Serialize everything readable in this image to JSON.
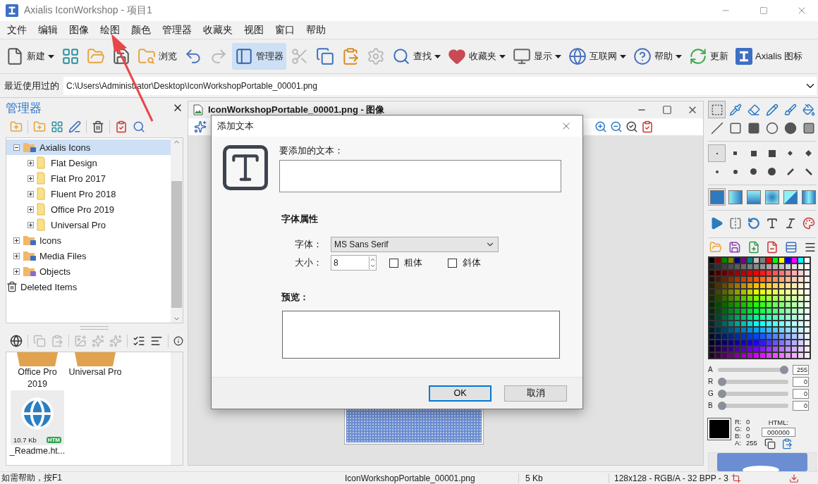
{
  "window": {
    "title": "Axialis IconWorkshop - 项目1"
  },
  "menu": [
    "文件",
    "编辑",
    "图像",
    "绘图",
    "颜色",
    "管理器",
    "收藏夹",
    "视图",
    "窗口",
    "帮助"
  ],
  "toolbar": [
    {
      "kind": "new",
      "label": "新建",
      "menu": true,
      "selected": false,
      "disabled": false
    },
    {
      "kind": "layout",
      "menu": false,
      "selected": false,
      "disabled": false
    },
    {
      "kind": "open",
      "menu": false,
      "selected": false,
      "disabled": false
    },
    {
      "kind": "save",
      "menu": false,
      "selected": false,
      "disabled": false
    },
    {
      "kind": "browse",
      "label": "浏览",
      "menu": false,
      "selected": false,
      "disabled": false
    },
    {
      "kind": "undo",
      "menu": false,
      "selected": false,
      "disabled": false
    },
    {
      "kind": "redo",
      "menu": false,
      "selected": false,
      "disabled": true
    },
    {
      "kind": "manager",
      "label": "管理器",
      "menu": false,
      "selected": true,
      "disabled": false
    },
    {
      "kind": "cut",
      "menu": false,
      "selected": false,
      "disabled": true
    },
    {
      "kind": "copy",
      "menu": false,
      "selected": false,
      "disabled": false
    },
    {
      "kind": "paste",
      "menu": false,
      "selected": false,
      "disabled": false
    },
    {
      "kind": "settings",
      "menu": false,
      "selected": false,
      "disabled": true
    },
    {
      "kind": "search",
      "label": "查找",
      "menu": true,
      "selected": false,
      "disabled": false
    },
    {
      "kind": "favorites",
      "label": "收藏夹",
      "menu": true,
      "selected": false,
      "disabled": false
    },
    {
      "kind": "display",
      "label": "显示",
      "menu": true,
      "selected": false,
      "disabled": false
    },
    {
      "kind": "internet",
      "label": "互联网",
      "menu": true,
      "selected": false,
      "disabled": false
    },
    {
      "kind": "help",
      "label": "帮助",
      "menu": true,
      "selected": false,
      "disabled": false
    },
    {
      "kind": "update",
      "label": "更新",
      "menu": false,
      "selected": false,
      "disabled": false
    },
    {
      "kind": "logo",
      "label": "Axialis 图标",
      "menu": false,
      "selected": false,
      "disabled": false
    }
  ],
  "recent": {
    "label": "最近使用过的",
    "value": "C:\\Users\\Administrator\\Desktop\\IconWorkshopPortable_00001.png"
  },
  "manager": {
    "title": "管理器",
    "tree": [
      {
        "label": "Axialis Icons",
        "kind": "library",
        "expanded": true,
        "selected": true,
        "children": [
          {
            "label": "Flat Design",
            "kind": "folder",
            "expanded": false,
            "selected": false
          },
          {
            "label": "Flat Pro 2017",
            "kind": "folder",
            "expanded": false,
            "selected": false
          },
          {
            "label": "Fluent Pro 2018",
            "kind": "folder",
            "expanded": false,
            "selected": false
          },
          {
            "label": "Office Pro 2019",
            "kind": "folder",
            "expanded": false,
            "selected": false
          },
          {
            "label": "Universal Pro",
            "kind": "folder",
            "expanded": false,
            "selected": false
          }
        ]
      },
      {
        "label": "Icons",
        "kind": "icons",
        "expanded": false,
        "selected": false
      },
      {
        "label": "Media Files",
        "kind": "media",
        "expanded": false,
        "selected": false
      },
      {
        "label": "Objects",
        "kind": "objects",
        "expanded": false,
        "selected": false
      },
      {
        "label": "Deleted Items",
        "kind": "trash",
        "selected": false
      }
    ],
    "files": [
      {
        "kind": "folder",
        "label": "Office Pro 2019"
      },
      {
        "kind": "folder",
        "label": "Universal Pro"
      },
      {
        "kind": "file",
        "label": "_Readme.ht...",
        "size": "10.7 Kb",
        "badge": "HTM"
      }
    ]
  },
  "document": {
    "title": "IconWorkshopPortable_00001.png - 图像"
  },
  "dialog": {
    "title": "添加文本",
    "text_label": "要添加的文本：",
    "section": "字体属性",
    "font_label": "字体：",
    "font": "MS Sans Serif",
    "size_label": "大小：",
    "size": "8",
    "options": [
      {
        "label": "粗体",
        "checked": false
      },
      {
        "label": "斜体",
        "checked": false
      }
    ],
    "preview_label": "预览：",
    "buttons": [
      {
        "label": "OK",
        "default": true
      },
      {
        "label": "取消",
        "default": false
      }
    ]
  },
  "tools": [
    {
      "kind": "select",
      "selected": true
    },
    {
      "kind": "picker",
      "selected": false
    },
    {
      "kind": "eraser",
      "selected": false
    },
    {
      "kind": "pencil",
      "selected": false
    },
    {
      "kind": "brush",
      "selected": false
    },
    {
      "kind": "bucket",
      "selected": false
    },
    {
      "kind": "line",
      "selected": false
    },
    {
      "kind": "rect",
      "selected": false
    },
    {
      "kind": "rect-fill",
      "selected": false
    },
    {
      "kind": "ellipse",
      "selected": false
    },
    {
      "kind": "ellipse-fill",
      "selected": false
    },
    {
      "kind": "shaded",
      "selected": false
    }
  ],
  "brushes": [
    {
      "kind": "dot",
      "selected": true
    },
    {
      "kind": "small-square",
      "selected": false
    },
    {
      "kind": "square",
      "selected": false
    },
    {
      "kind": "large-square",
      "selected": false
    },
    {
      "kind": "diamond",
      "selected": false
    },
    {
      "kind": "large-diamond",
      "selected": false
    },
    {
      "kind": "tiny-round",
      "selected": false
    },
    {
      "kind": "small-round",
      "selected": false
    },
    {
      "kind": "round",
      "selected": false
    },
    {
      "kind": "large-round",
      "selected": false
    },
    {
      "kind": "slash",
      "selected": false
    },
    {
      "kind": "backslash",
      "selected": false
    }
  ],
  "fills": [
    {
      "kind": "solid",
      "selected": true
    },
    {
      "kind": "linear",
      "selected": false
    },
    {
      "kind": "vertical",
      "selected": false
    },
    {
      "kind": "radial",
      "selected": false
    },
    {
      "kind": "diagonal",
      "selected": false
    },
    {
      "kind": "horizontal",
      "selected": false
    }
  ],
  "channels": [
    {
      "name": "A",
      "level": 1,
      "value": "255"
    },
    {
      "name": "R",
      "level": 0,
      "value": "0"
    },
    {
      "name": "G",
      "level": 0,
      "value": "0"
    },
    {
      "name": "B",
      "level": 0,
      "value": "0"
    }
  ],
  "readout": [
    {
      "label": "R:",
      "value": "0"
    },
    {
      "label": "G:",
      "value": "0"
    },
    {
      "label": "B:",
      "value": "0"
    },
    {
      "label": "A:",
      "value": "255"
    }
  ],
  "html": {
    "label": "HTML:",
    "value": "000000"
  },
  "status_bar": [
    "如需帮助，按F1",
    "IconWorkshopPortable_00001.png",
    "5 Kb",
    "128x128 - RGB/A - 32 BPP - 3"
  ]
}
